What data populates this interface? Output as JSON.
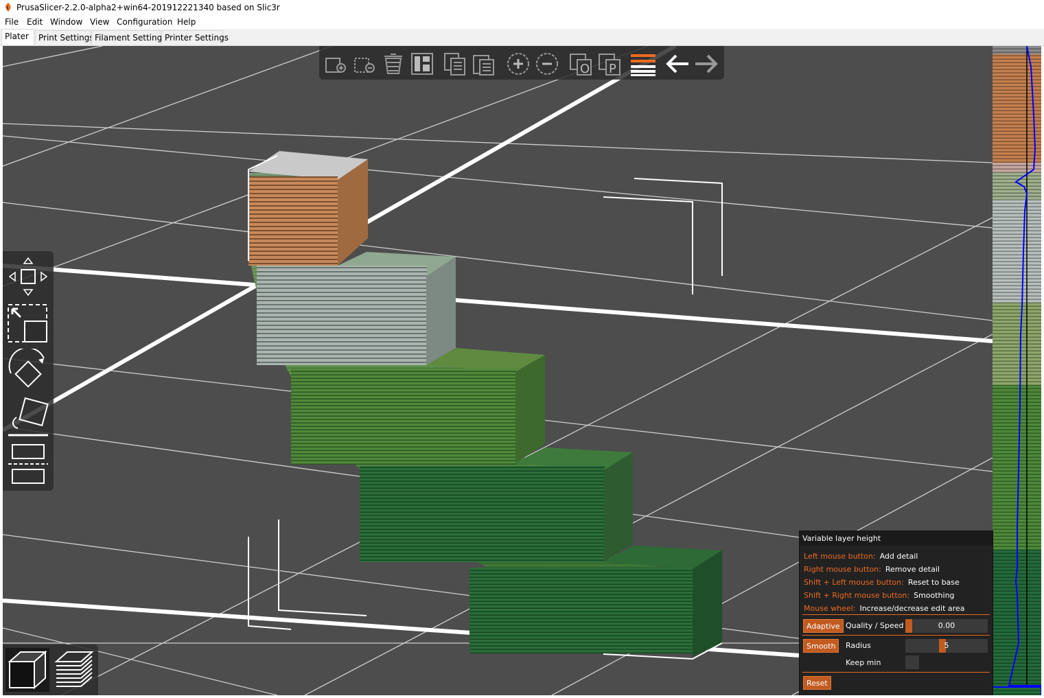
{
  "window": {
    "title": "PrusaSlicer-2.2.0-alpha2+win64-201912221340 based on Slic3r"
  },
  "menu": [
    "File",
    "Edit",
    "Window",
    "View",
    "Configuration",
    "Help"
  ],
  "tabs": [
    "Plater",
    "Print Settings",
    "Filament Settings",
    "Printer Settings"
  ],
  "active_tab": "Plater",
  "top_toolbar": [
    {
      "name": "add-icon"
    },
    {
      "name": "delete-icon"
    },
    {
      "name": "delete-all-icon"
    },
    {
      "name": "arrange-icon"
    },
    {
      "name": "copy-icon"
    },
    {
      "name": "paste-icon"
    },
    {
      "name": "add-instance-icon"
    },
    {
      "name": "remove-instance-icon"
    },
    {
      "name": "split-objects-icon"
    },
    {
      "name": "split-parts-icon"
    },
    {
      "name": "layers-editing-icon"
    },
    {
      "name": "undo-icon"
    },
    {
      "name": "redo-icon"
    }
  ],
  "left_toolbar": [
    {
      "name": "move-icon"
    },
    {
      "name": "scale-icon"
    },
    {
      "name": "rotate-icon"
    },
    {
      "name": "place-on-face-icon"
    },
    {
      "name": "cut-icon"
    }
  ],
  "view_toggle": [
    {
      "name": "3d-view-icon"
    },
    {
      "name": "preview-icon"
    }
  ],
  "layer_panel": {
    "title": "Variable layer height",
    "hints": [
      {
        "key": "Left mouse button:",
        "value": "Add detail"
      },
      {
        "key": "Right mouse button:",
        "value": "Remove detail"
      },
      {
        "key": "Shift + Left mouse button:",
        "value": "Reset to base"
      },
      {
        "key": "Shift + Right mouse button:",
        "value": "Smoothing"
      },
      {
        "key": "Mouse wheel:",
        "value": "Increase/decrease edit area"
      }
    ],
    "adaptive_button": "Adaptive",
    "quality_label": "Quality / Speed",
    "quality_value": "0.00",
    "quality_fraction": 0.0,
    "smooth_button": "Smooth",
    "radius_label": "Radius",
    "radius_value": "5",
    "radius_fraction": 0.5,
    "keep_min_label": "Keep min",
    "keep_min_checked": false,
    "reset_button": "Reset"
  },
  "colors": {
    "accent": "#ed6b21",
    "viewport_bg": "#4d4d4d",
    "profile_line": "#0000ff"
  }
}
